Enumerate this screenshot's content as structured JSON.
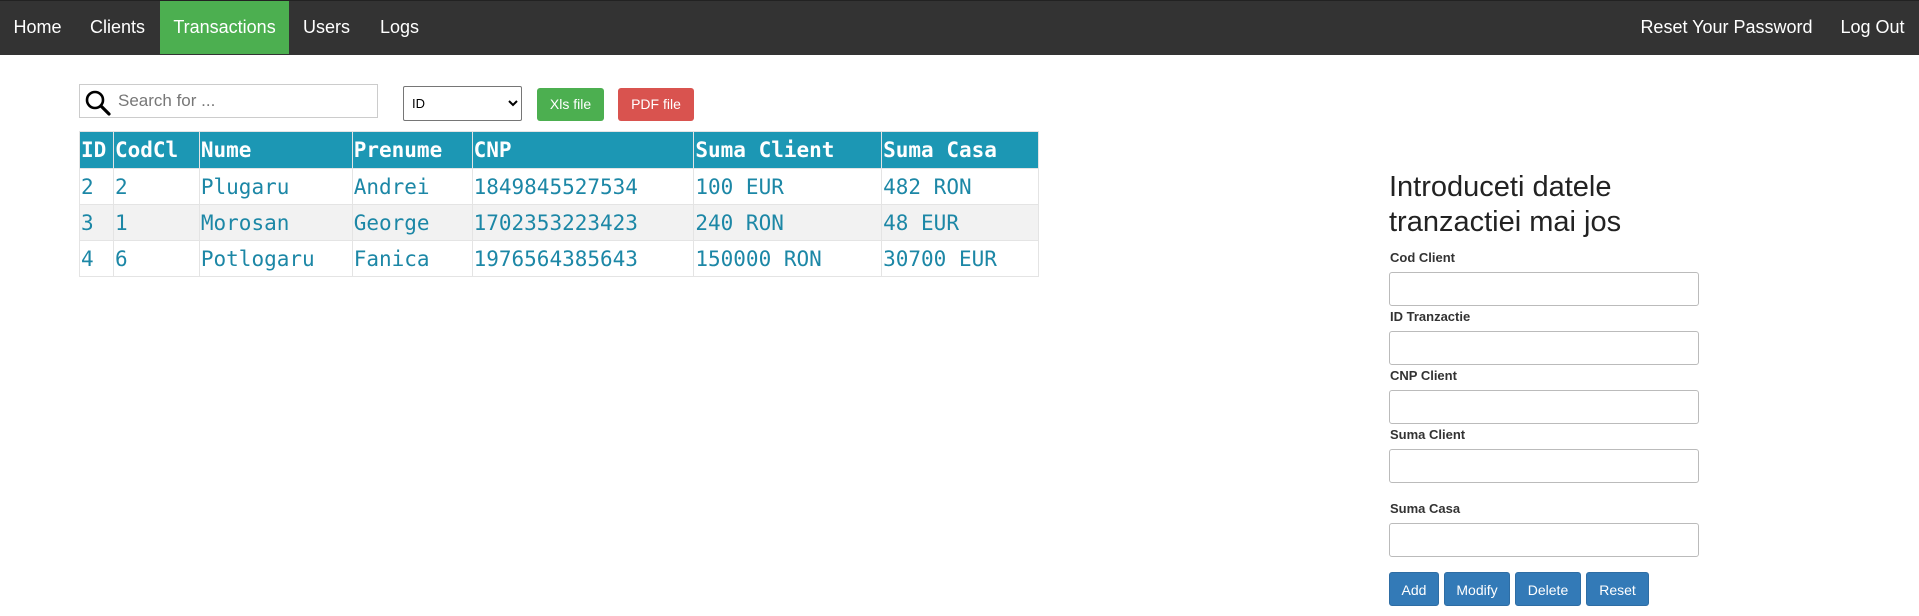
{
  "nav": {
    "home": "Home",
    "clients": "Clients",
    "transactions": "Transactions",
    "users": "Users",
    "logs": "Logs",
    "reset_password": "Reset Your Password",
    "logout": "Log Out",
    "active_color": "#4caf50"
  },
  "toolbar": {
    "search_placeholder": "Search for ...",
    "filter_selected": "ID",
    "xls_label": "Xls file",
    "pdf_label": "PDF file"
  },
  "table": {
    "columns": [
      "ID",
      "CodCl",
      "Nume",
      "Prenume",
      "CNP",
      "Suma Client",
      "Suma Casa"
    ],
    "rows": [
      [
        "2",
        "2",
        "Plugaru",
        "Andrei",
        "1849845527534",
        "100 EUR",
        "482 RON"
      ],
      [
        "3",
        "1",
        "Morosan",
        "George",
        "1702353223423",
        "240 RON",
        "48 EUR"
      ],
      [
        "4",
        "6",
        "Potlogaru",
        "Fanica",
        "1976564385643",
        "150000 RON",
        "30700 EUR"
      ]
    ],
    "header_color": "#1c97b4"
  },
  "form": {
    "title": "Introduceti datele tranzactiei mai jos",
    "fields": [
      {
        "label": "Cod Client"
      },
      {
        "label": "ID Tranzactie"
      },
      {
        "label": "CNP Client"
      },
      {
        "label": "Suma Client"
      },
      {
        "label": "Suma Casa"
      }
    ],
    "buttons": {
      "add": "Add",
      "modify": "Modify",
      "delete": "Delete",
      "reset": "Reset"
    }
  }
}
